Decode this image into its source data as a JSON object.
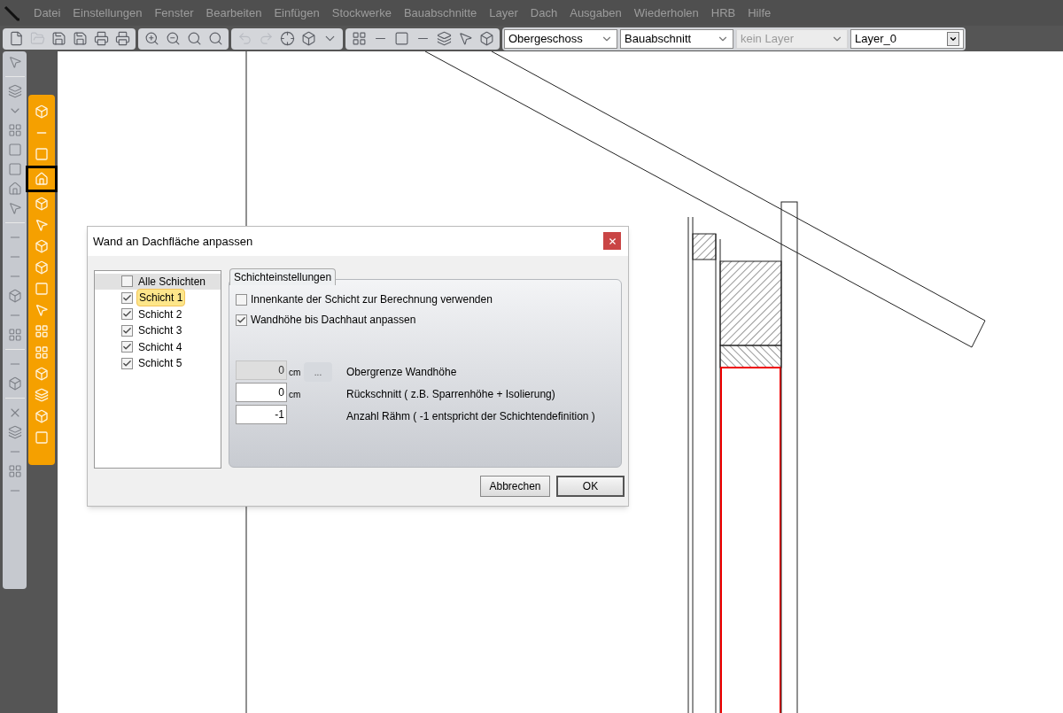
{
  "menu": [
    "Datei",
    "Einstellungen",
    "Fenster",
    "Bearbeiten",
    "Einfügen",
    "Stockwerke",
    "Bauabschnitte",
    "Layer",
    "Dach",
    "Ausgaben",
    "Wiederholen",
    "HRB",
    "Hilfe"
  ],
  "history": {
    "undo_disabled": true,
    "redo_disabled": true
  },
  "selectors": [
    {
      "value": "Obergeschoss",
      "disabled": false,
      "kind": "flat"
    },
    {
      "value": "Bauabschnitt",
      "disabled": false,
      "kind": "flat"
    },
    {
      "value": "kein Layer",
      "disabled": true,
      "kind": "flat"
    },
    {
      "value": "Layer_0",
      "disabled": false,
      "kind": "boxed"
    }
  ],
  "orange_tools": [
    {
      "selected": false
    },
    {
      "selected": false
    },
    {
      "selected": false
    },
    {
      "selected": true
    },
    {
      "selected": false
    },
    {
      "selected": false
    },
    {
      "selected": false
    },
    {
      "selected": false
    },
    {
      "selected": false
    },
    {
      "selected": false
    },
    {
      "selected": false
    },
    {
      "selected": false
    },
    {
      "selected": false
    },
    {
      "selected": false
    },
    {
      "selected": false
    },
    {
      "selected": false
    }
  ],
  "dialog": {
    "title": "Wand an Dachfläche anpassen",
    "layers": [
      {
        "label": "Alle Schichten",
        "checked": false,
        "selected": false
      },
      {
        "label": "Schicht 1",
        "checked": true,
        "selected": true
      },
      {
        "label": "Schicht 2",
        "checked": true,
        "selected": false
      },
      {
        "label": "Schicht 3",
        "checked": true,
        "selected": false
      },
      {
        "label": "Schicht 4",
        "checked": true,
        "selected": false
      },
      {
        "label": "Schicht 5",
        "checked": true,
        "selected": false
      }
    ],
    "group_title": "Schichteinstellungen",
    "options": [
      {
        "label": "Innenkante der Schicht zur Berechnung verwenden",
        "checked": false
      },
      {
        "label": "Wandhöhe bis Dachhaut anpassen",
        "checked": true
      }
    ],
    "fields": [
      {
        "value": "0",
        "unit": "cm",
        "disabled": true,
        "browse": "...",
        "label": "Obergrenze Wandhöhe"
      },
      {
        "value": "0",
        "unit": "cm",
        "disabled": false,
        "label": "Rückschnitt ( z.B. Sparrenhöhe + Isolierung)"
      },
      {
        "value": "-1",
        "disabled": false,
        "label": "Anzahl Rähm ( -1 entspricht der Schichtendefinition )"
      }
    ],
    "buttons": [
      "Abbrechen",
      "OK"
    ]
  }
}
